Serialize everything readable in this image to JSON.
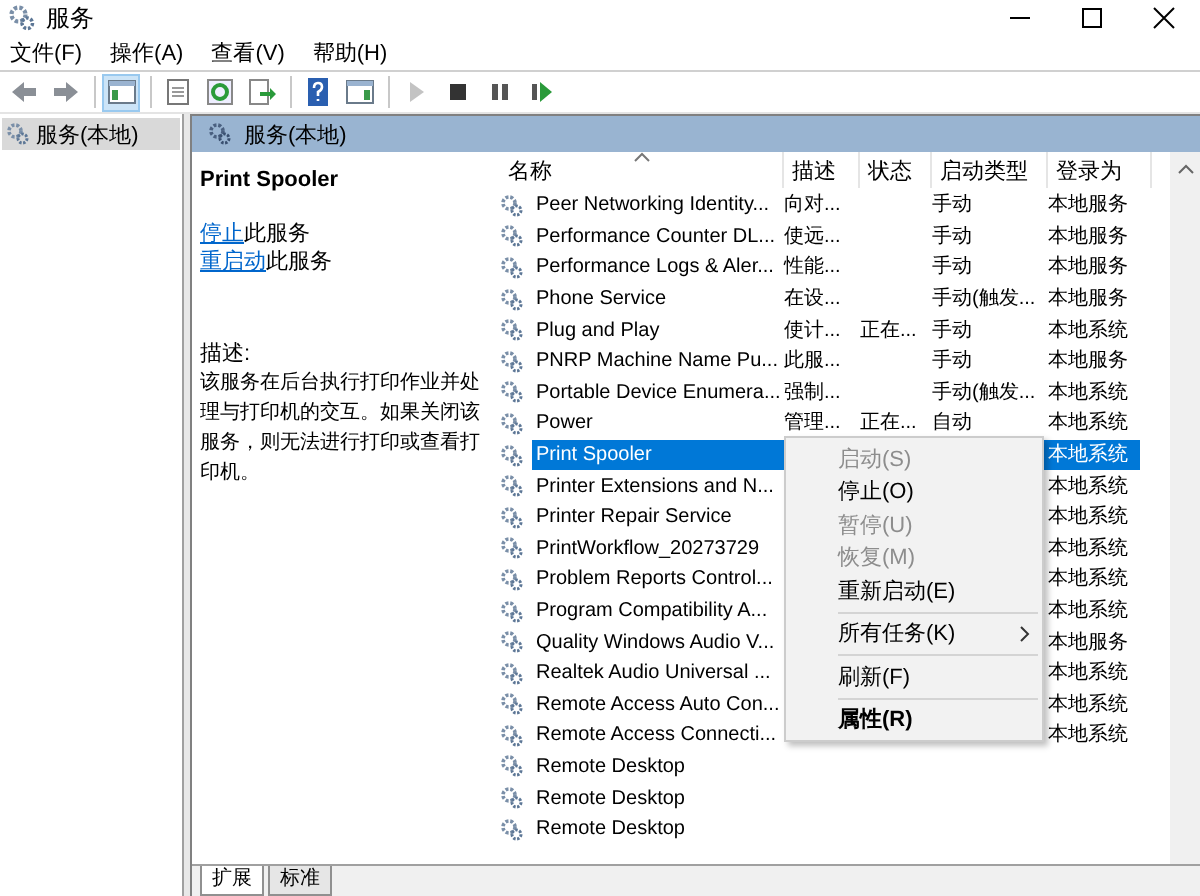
{
  "window": {
    "title": "服务"
  },
  "menu": [
    "文件(F)",
    "操作(A)",
    "查看(V)",
    "帮助(H)"
  ],
  "toolbar": [
    {
      "kind": "back",
      "pressed": false,
      "disabled": false
    },
    {
      "kind": "forward",
      "pressed": false,
      "disabled": false
    },
    {
      "kind": "sep"
    },
    {
      "kind": "tree",
      "pressed": true,
      "disabled": false
    },
    {
      "kind": "sep"
    },
    {
      "kind": "properties",
      "pressed": false,
      "disabled": false
    },
    {
      "kind": "refresh",
      "pressed": false,
      "disabled": false
    },
    {
      "kind": "export",
      "pressed": false,
      "disabled": false
    },
    {
      "kind": "sep"
    },
    {
      "kind": "help",
      "pressed": false,
      "disabled": false
    },
    {
      "kind": "pane",
      "pressed": false,
      "disabled": false
    },
    {
      "kind": "sep"
    },
    {
      "kind": "play",
      "pressed": false,
      "disabled": true
    },
    {
      "kind": "stop",
      "pressed": false,
      "disabled": false
    },
    {
      "kind": "pause",
      "pressed": false,
      "disabled": false
    },
    {
      "kind": "resume",
      "pressed": false,
      "disabled": false
    }
  ],
  "tree": {
    "items": [
      {
        "label": "服务(本地)",
        "selected": true
      }
    ]
  },
  "header": "服务(本地)",
  "detail": {
    "title": "Print Spooler",
    "actions": [
      {
        "link": "停止",
        "text": "此服务"
      },
      {
        "link": "重启动",
        "text": "此服务"
      }
    ],
    "description_label": "描述:",
    "description": "该服务在后台执行打印作业并处理与打印机的交互。如果关闭该服务，则无法进行打印或查看打印机。"
  },
  "table": {
    "columns": [
      {
        "label": "名称",
        "sorted": true
      },
      {
        "label": "描述",
        "sorted": false
      },
      {
        "label": "状态",
        "sorted": false
      },
      {
        "label": "启动类型",
        "sorted": false
      },
      {
        "label": "登录为",
        "sorted": false
      }
    ],
    "rows": [
      {
        "name": "Peer Networking Identity...",
        "description": "向对...",
        "status": "",
        "startup": "手动",
        "logon": "本地服务",
        "selected": false
      },
      {
        "name": "Performance Counter DL...",
        "description": "使远...",
        "status": "",
        "startup": "手动",
        "logon": "本地服务",
        "selected": false
      },
      {
        "name": "Performance Logs & Aler...",
        "description": "性能...",
        "status": "",
        "startup": "手动",
        "logon": "本地服务",
        "selected": false
      },
      {
        "name": "Phone Service",
        "description": "在设...",
        "status": "",
        "startup": "手动(触发...",
        "logon": "本地服务",
        "selected": false
      },
      {
        "name": "Plug and Play",
        "description": "使计...",
        "status": "正在...",
        "startup": "手动",
        "logon": "本地系统",
        "selected": false
      },
      {
        "name": "PNRP Machine Name Pu...",
        "description": "此服...",
        "status": "",
        "startup": "手动",
        "logon": "本地服务",
        "selected": false
      },
      {
        "name": "Portable Device Enumera...",
        "description": "强制...",
        "status": "",
        "startup": "手动(触发...",
        "logon": "本地系统",
        "selected": false
      },
      {
        "name": "Power",
        "description": "管理...",
        "status": "正在...",
        "startup": "自动",
        "logon": "本地系统",
        "selected": false
      },
      {
        "name": "Print Spooler",
        "description": "",
        "status": "",
        "startup": "",
        "logon": "本地系统",
        "selected": true
      },
      {
        "name": "Printer Extensions and N...",
        "description": "",
        "status": "",
        "startup": "",
        "logon": "本地系统",
        "selected": false
      },
      {
        "name": "Printer Repair Service",
        "description": "",
        "status": "",
        "startup": "",
        "logon": "本地系统",
        "selected": false
      },
      {
        "name": "PrintWorkflow_20273729",
        "description": "",
        "status": "",
        "startup": "",
        "logon": "本地系统",
        "selected": false
      },
      {
        "name": "Problem Reports Control...",
        "description": "",
        "status": "",
        "startup": "",
        "logon": "本地系统",
        "selected": false
      },
      {
        "name": "Program Compatibility A...",
        "description": "",
        "status": "",
        "startup": "",
        "logon": "本地系统",
        "selected": false
      },
      {
        "name": "Quality Windows Audio V...",
        "description": "",
        "status": "",
        "startup": "",
        "logon": "本地服务",
        "selected": false
      },
      {
        "name": "Realtek Audio Universal ...",
        "description": "",
        "status": "",
        "startup": "",
        "logon": "本地系统",
        "selected": false
      },
      {
        "name": "Remote Access Auto Con...",
        "description": "",
        "status": "",
        "startup": "",
        "logon": "本地系统",
        "selected": false
      },
      {
        "name": "Remote Access Connecti...",
        "description": "",
        "status": "",
        "startup": "",
        "logon": "本地系统",
        "selected": false
      },
      {
        "name": "Remote Desktop",
        "description": "",
        "status": "",
        "startup": "",
        "logon": "",
        "selected": false
      },
      {
        "name": "Remote Desktop",
        "description": "",
        "status": "",
        "startup": "",
        "logon": "",
        "selected": false
      },
      {
        "name": "Remote Desktop",
        "description": "",
        "status": "",
        "startup": "",
        "logon": "",
        "selected": false
      }
    ]
  },
  "context_menu": [
    {
      "kind": "item",
      "label": "启动(S)",
      "disabled": true,
      "bold": false,
      "submenu": false
    },
    {
      "kind": "item",
      "label": "停止(O)",
      "disabled": false,
      "bold": false,
      "submenu": false
    },
    {
      "kind": "item",
      "label": "暂停(U)",
      "disabled": true,
      "bold": false,
      "submenu": false
    },
    {
      "kind": "item",
      "label": "恢复(M)",
      "disabled": true,
      "bold": false,
      "submenu": false
    },
    {
      "kind": "item",
      "label": "重新启动(E)",
      "disabled": false,
      "bold": false,
      "submenu": false
    },
    {
      "kind": "separator"
    },
    {
      "kind": "item",
      "label": "所有任务(K)",
      "disabled": false,
      "bold": false,
      "submenu": true
    },
    {
      "kind": "separator"
    },
    {
      "kind": "item",
      "label": "刷新(F)",
      "disabled": false,
      "bold": false,
      "submenu": false
    },
    {
      "kind": "separator"
    },
    {
      "kind": "item",
      "label": "属性(R)",
      "disabled": false,
      "bold": true,
      "submenu": false
    }
  ],
  "bottom_tabs": [
    {
      "label": "扩展",
      "selected": true
    },
    {
      "label": "标准",
      "selected": false
    }
  ]
}
